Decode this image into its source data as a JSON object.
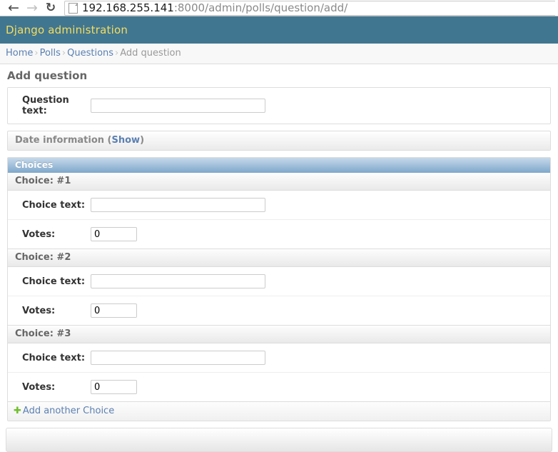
{
  "browser": {
    "back_icon": "arrow-left-icon",
    "forward_icon": "arrow-right-icon",
    "reload_icon": "reload-icon",
    "page_icon": "page-document-icon",
    "url_host": "192.168.255.141",
    "url_rest": ":8000/admin/polls/question/add/",
    "url_full": "192.168.255.141:8000/admin/polls/question/add/"
  },
  "header": {
    "site_title": "Django administration"
  },
  "breadcrumbs": {
    "items": [
      {
        "label": "Home",
        "link": true
      },
      {
        "label": "Polls",
        "link": true
      },
      {
        "label": "Questions",
        "link": true
      },
      {
        "label": "Add question",
        "link": false
      }
    ],
    "separator": "›"
  },
  "page": {
    "title": "Add question"
  },
  "question_fieldset": {
    "rows": [
      {
        "label": "Question text:",
        "value": "",
        "type": "text"
      }
    ]
  },
  "date_fieldset": {
    "title": "Date information",
    "open_paren": "(",
    "toggle_label": "Show",
    "close_paren": ")"
  },
  "choices_inline": {
    "heading": "Choices",
    "items": [
      {
        "heading": "Choice: #1",
        "text_label": "Choice text:",
        "text_value": "",
        "votes_label": "Votes:",
        "votes_value": "0"
      },
      {
        "heading": "Choice: #2",
        "text_label": "Choice text:",
        "text_value": "",
        "votes_label": "Votes:",
        "votes_value": "0"
      },
      {
        "heading": "Choice: #3",
        "text_label": "Choice text:",
        "text_value": "",
        "votes_label": "Votes:",
        "votes_value": "0"
      }
    ],
    "add_row": {
      "icon": "plus-icon",
      "icon_glyph": "✚",
      "label": "Add another Choice"
    }
  },
  "colors": {
    "header_bg": "#417690",
    "header_text": "#f5dd5d",
    "link": "#5b80b2",
    "inline_heading_bg": "#7ea7cb",
    "add_icon_green": "#70bf2b"
  }
}
